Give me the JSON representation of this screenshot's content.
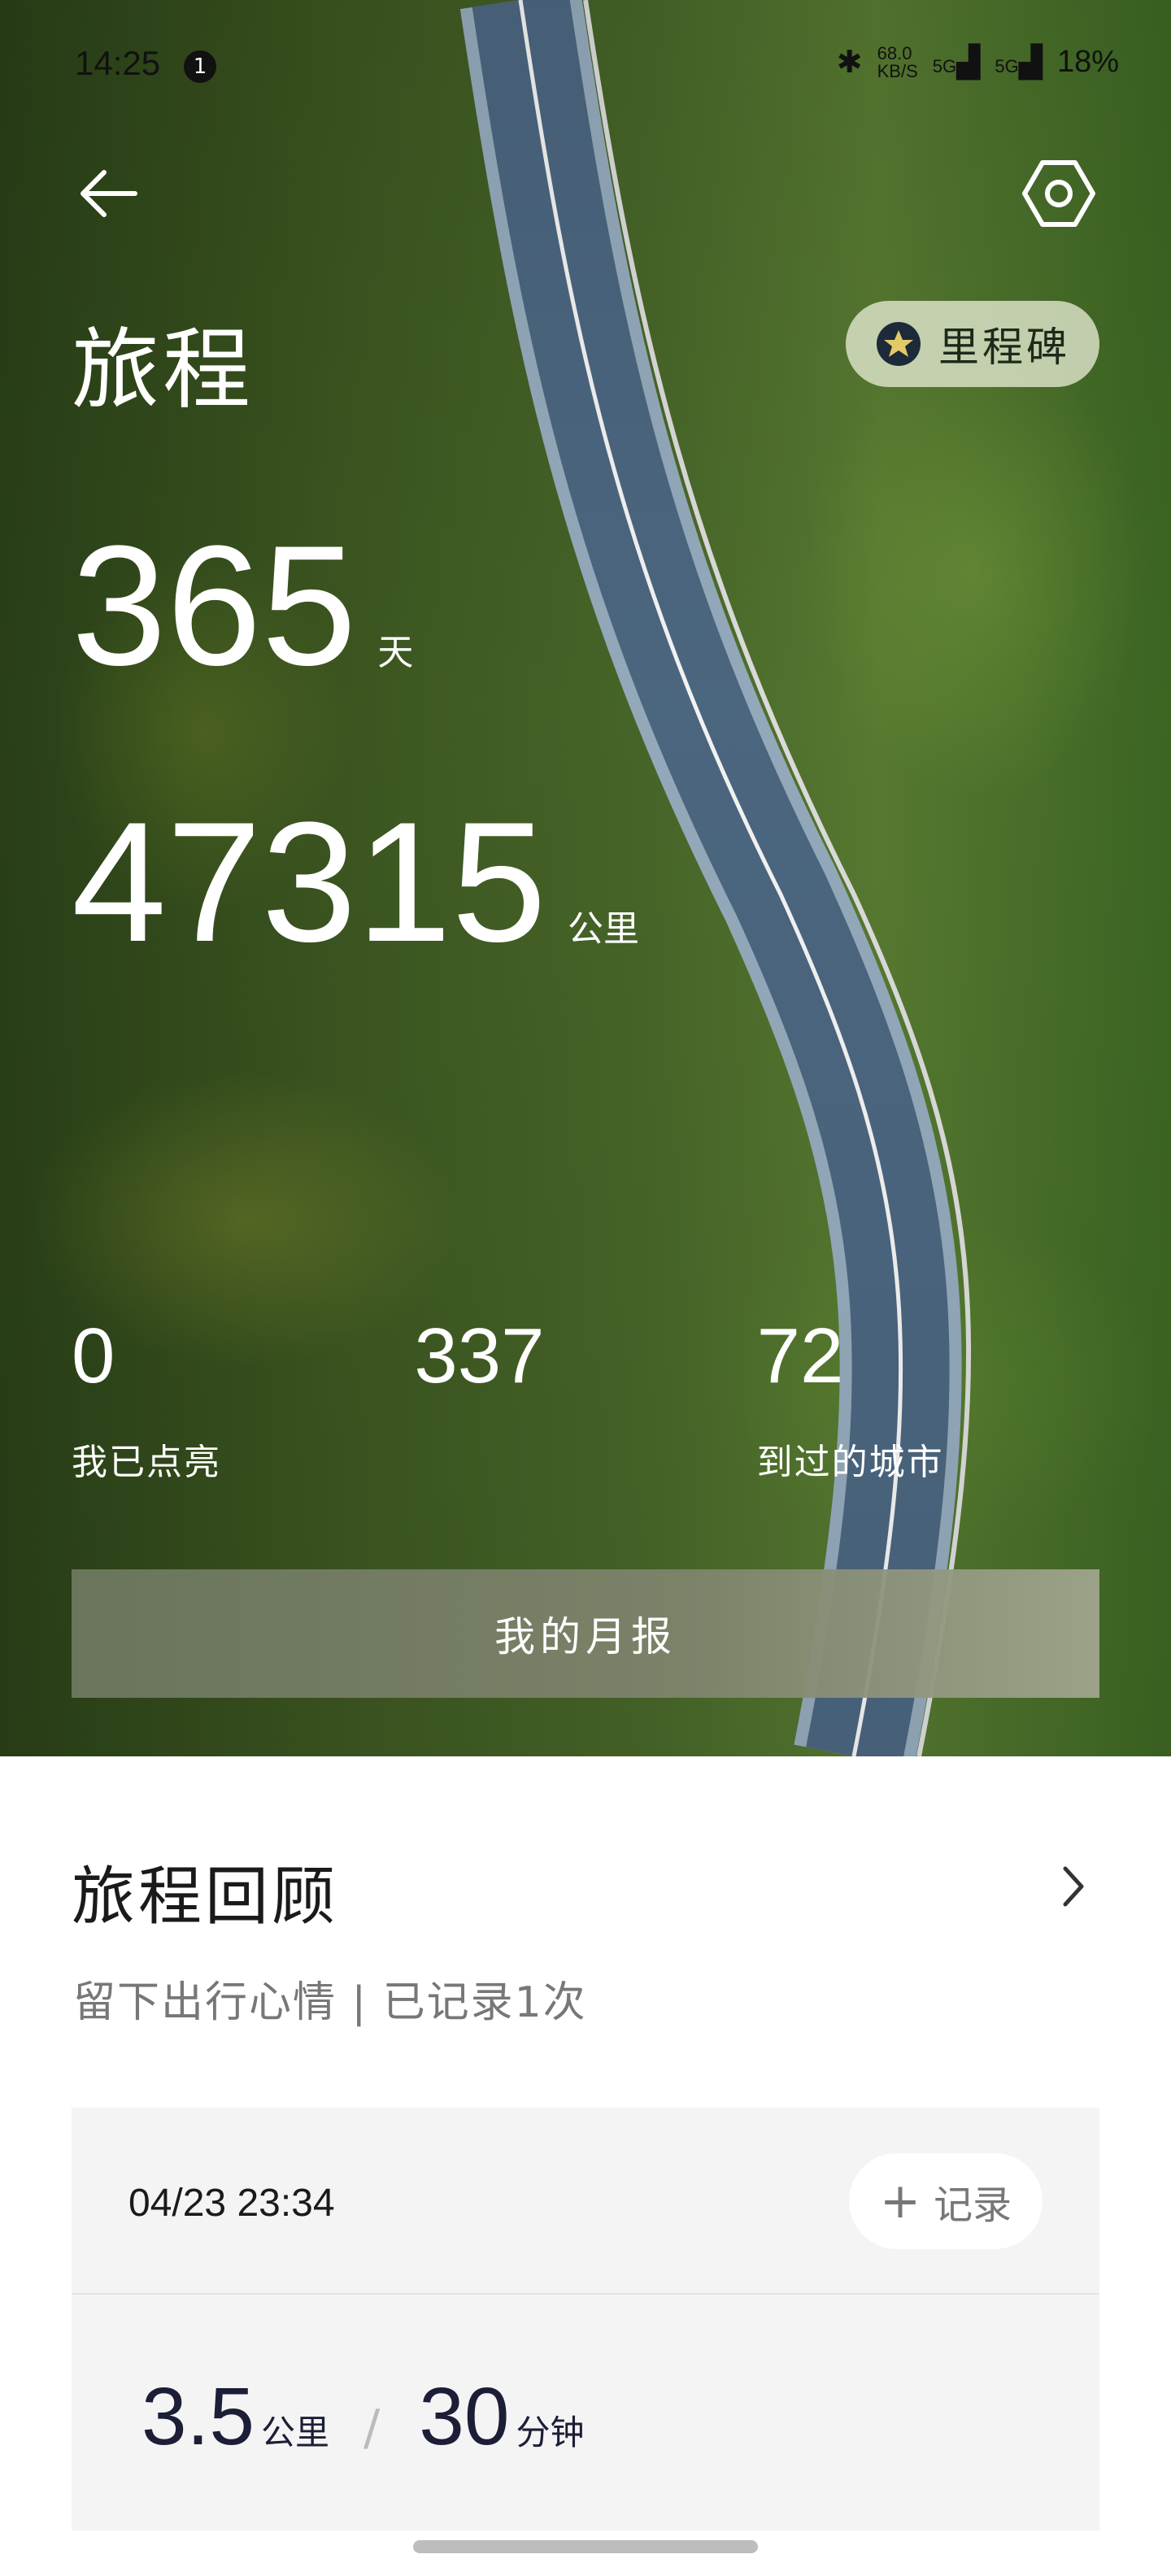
{
  "status_bar": {
    "time": "14:25",
    "notification_badge": "1",
    "net_speed_top": "68.0",
    "net_speed_bottom": "KB/S",
    "signal_1": "5G",
    "signal_2": "5G",
    "battery": "18%"
  },
  "header": {
    "title": "旅程",
    "milestone_label": "里程碑",
    "back_icon": "arrow-left-icon",
    "settings_icon": "hexagon-settings-icon"
  },
  "stats": {
    "days_value": "365",
    "days_unit": "天",
    "distance_value": "47315",
    "distance_unit": "公里"
  },
  "mini_stats": [
    {
      "value": "0",
      "label": "我已点亮"
    },
    {
      "value": "337",
      "label": ""
    },
    {
      "value": "72",
      "label": "到过的城市"
    }
  ],
  "report_button": "我的月报",
  "review": {
    "title": "旅程回顾",
    "subtitle": "留下出行心情 | 已记录1次"
  },
  "trip_card": {
    "datetime": "04/23 23:34",
    "record_label": "记录",
    "distance_value": "3.5",
    "distance_unit": "公里",
    "separator": "/",
    "duration_value": "30",
    "duration_unit": "分钟"
  },
  "colors": {
    "accent_dark": "#1b1e36",
    "report_button": "#7b8468",
    "milestone_bg": "#e6ebd2"
  }
}
